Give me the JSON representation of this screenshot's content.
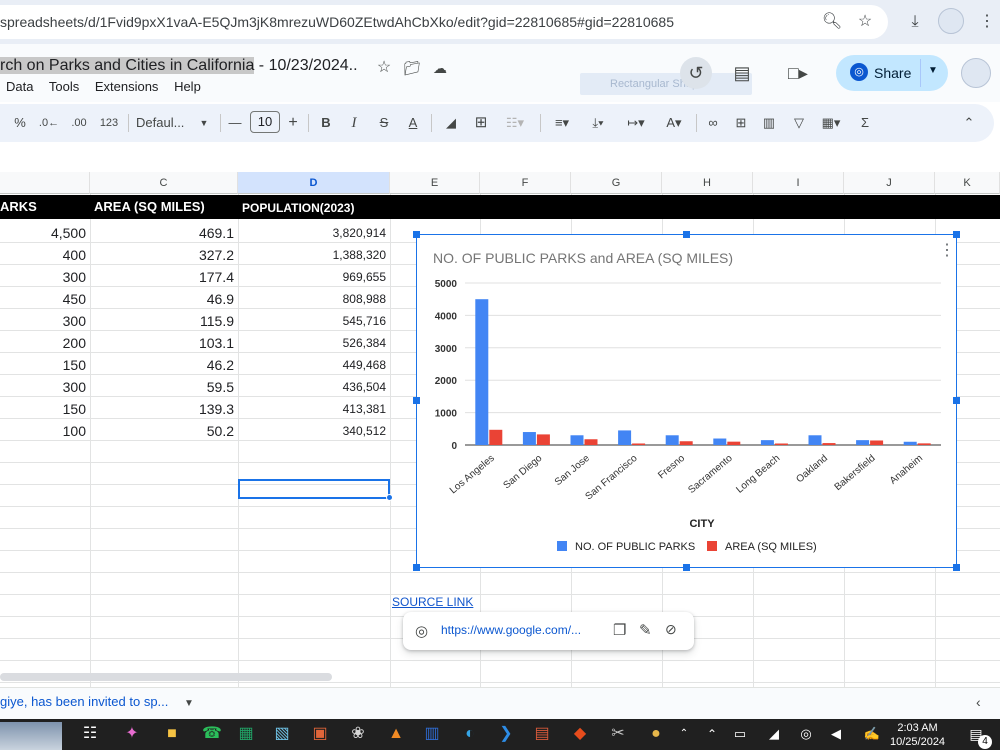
{
  "browser": {
    "url": "spreadsheets/d/1Fvid9pxX1vaA-E5QJm3jK8mrezuWD60ZEtwdAhCbXko/edit?gid=22810685#gid=22810685"
  },
  "doc": {
    "title_highlight": "rch on Parks and Cities in California",
    "title_rest": " - 10/23/2024..",
    "menu": [
      "Data",
      "Tools",
      "Extensions",
      "Help"
    ],
    "share_label": "Share",
    "ghost_tab": "Rectangular Shap"
  },
  "toolbar": {
    "percent": "%",
    "dec_decrease": ".0←",
    "dec_increase": ".00",
    "num_format": "123",
    "font": "Defaul...",
    "font_size": "10",
    "minus": "—",
    "plus": "+",
    "bold": "B",
    "italic": "I",
    "strike": "S",
    "textcolor": "A",
    "sigma": "Σ"
  },
  "columns": [
    "C",
    "D",
    "E",
    "F",
    "G",
    "H",
    "I",
    "J",
    "K"
  ],
  "header_row": {
    "b": "ARKS",
    "c": "AREA (SQ MILES)",
    "d": "POPULATION(2023)"
  },
  "rows": [
    {
      "parks": "4,500",
      "area": "469.1",
      "pop": "3,820,914"
    },
    {
      "parks": "400",
      "area": "327.2",
      "pop": "1,388,320"
    },
    {
      "parks": "300",
      "area": "177.4",
      "pop": "969,655"
    },
    {
      "parks": "450",
      "area": "46.9",
      "pop": "808,988"
    },
    {
      "parks": "300",
      "area": "115.9",
      "pop": "545,716"
    },
    {
      "parks": "200",
      "area": "103.1",
      "pop": "526,384"
    },
    {
      "parks": "150",
      "area": "46.2",
      "pop": "449,468"
    },
    {
      "parks": "300",
      "area": "59.5",
      "pop": "436,504"
    },
    {
      "parks": "150",
      "area": "139.3",
      "pop": "413,381"
    },
    {
      "parks": "100",
      "area": "50.2",
      "pop": "340,512"
    }
  ],
  "chart_data": {
    "type": "bar",
    "title": "NO. OF PUBLIC PARKS and AREA (SQ MILES)",
    "xlabel": "CITY",
    "ylabel": "",
    "ylim": [
      0,
      5000
    ],
    "yticks": [
      "0",
      "1000",
      "2000",
      "3000",
      "4000",
      "5000"
    ],
    "categories": [
      "Los Angeles",
      "San Diego",
      "San Jose",
      "San Francisco",
      "Fresno",
      "Sacramento",
      "Long Beach",
      "Oakland",
      "Bakersfield",
      "Anaheim"
    ],
    "series": [
      {
        "name": "NO. OF PUBLIC PARKS",
        "color": "#4285f4",
        "values": [
          4500,
          400,
          300,
          450,
          300,
          200,
          150,
          300,
          150,
          100
        ]
      },
      {
        "name": "AREA (SQ MILES)",
        "color": "#ea4335",
        "values": [
          469.1,
          327.2,
          177.4,
          46.9,
          115.9,
          103.1,
          46.2,
          59.5,
          139.3,
          50.2
        ]
      }
    ],
    "legend": "bottom",
    "grid": true
  },
  "link": {
    "source_label": "SOURCE LINK",
    "popup_url": "https://www.google.com/..."
  },
  "notification": "giye, has been invited to sp...",
  "clock": {
    "time": "2:03 AM",
    "date": "10/25/2024"
  },
  "notif_count": "4"
}
